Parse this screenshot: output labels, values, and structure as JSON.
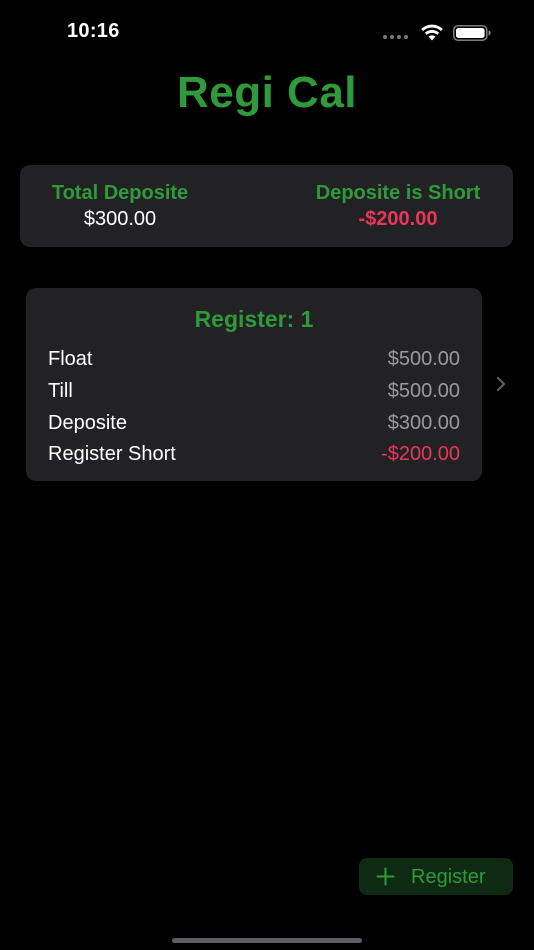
{
  "status_bar": {
    "time": "10:16"
  },
  "app": {
    "title": "Regi Cal"
  },
  "summary": {
    "total_label": "Total Deposite",
    "total_value": "$300.00",
    "short_label": "Deposite is Short",
    "short_value": "-$200.00"
  },
  "registers": [
    {
      "title": "Register: 1",
      "rows": [
        {
          "label": "Float",
          "value": "$500.00"
        },
        {
          "label": "Till",
          "value": "$500.00"
        },
        {
          "label": "Deposite",
          "value": "$300.00"
        },
        {
          "label": "Register Short",
          "value": "-$200.00"
        }
      ]
    }
  ],
  "add_button": {
    "label": "Register",
    "icon": "plus-icon"
  },
  "colors": {
    "accent_green": "#2e9a3a",
    "negative_red": "#e8365a",
    "card_bg": "#222224",
    "background": "#000000"
  }
}
